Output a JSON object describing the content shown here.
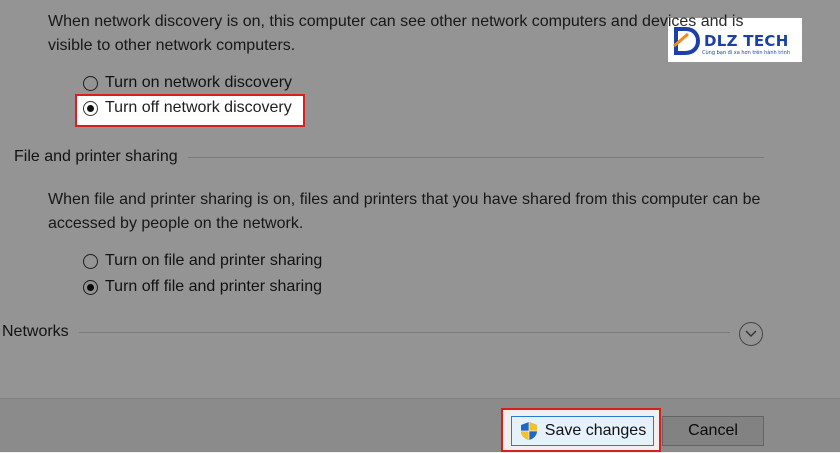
{
  "network_discovery": {
    "description": "When network discovery is on, this computer can see other network computers and devices and is visible to other network computers.",
    "option_on": "Turn on network discovery",
    "option_off": "Turn off network discovery",
    "selected": "off"
  },
  "file_printer_sharing": {
    "section_title": "File and printer sharing",
    "description": "When file and printer sharing is on, files and printers that you have shared from this computer can be accessed by people on the network.",
    "option_on": "Turn on file and printer sharing",
    "option_off": "Turn off file and printer sharing",
    "selected": "off"
  },
  "networks": {
    "section_title": "Networks",
    "expand_icon": "chevron-down-icon"
  },
  "footer": {
    "save_label": "Save changes",
    "cancel_label": "Cancel",
    "save_icon": "uac-shield-icon"
  },
  "watermark": {
    "brand": "DLZ TECH",
    "tagline": "Cùng bạn đi xa hơn trên hành trình"
  },
  "colors": {
    "highlight": "#d81e1e",
    "overlay": "rgba(0,0,0,0.42)",
    "brand_blue": "#1c3fa8"
  }
}
